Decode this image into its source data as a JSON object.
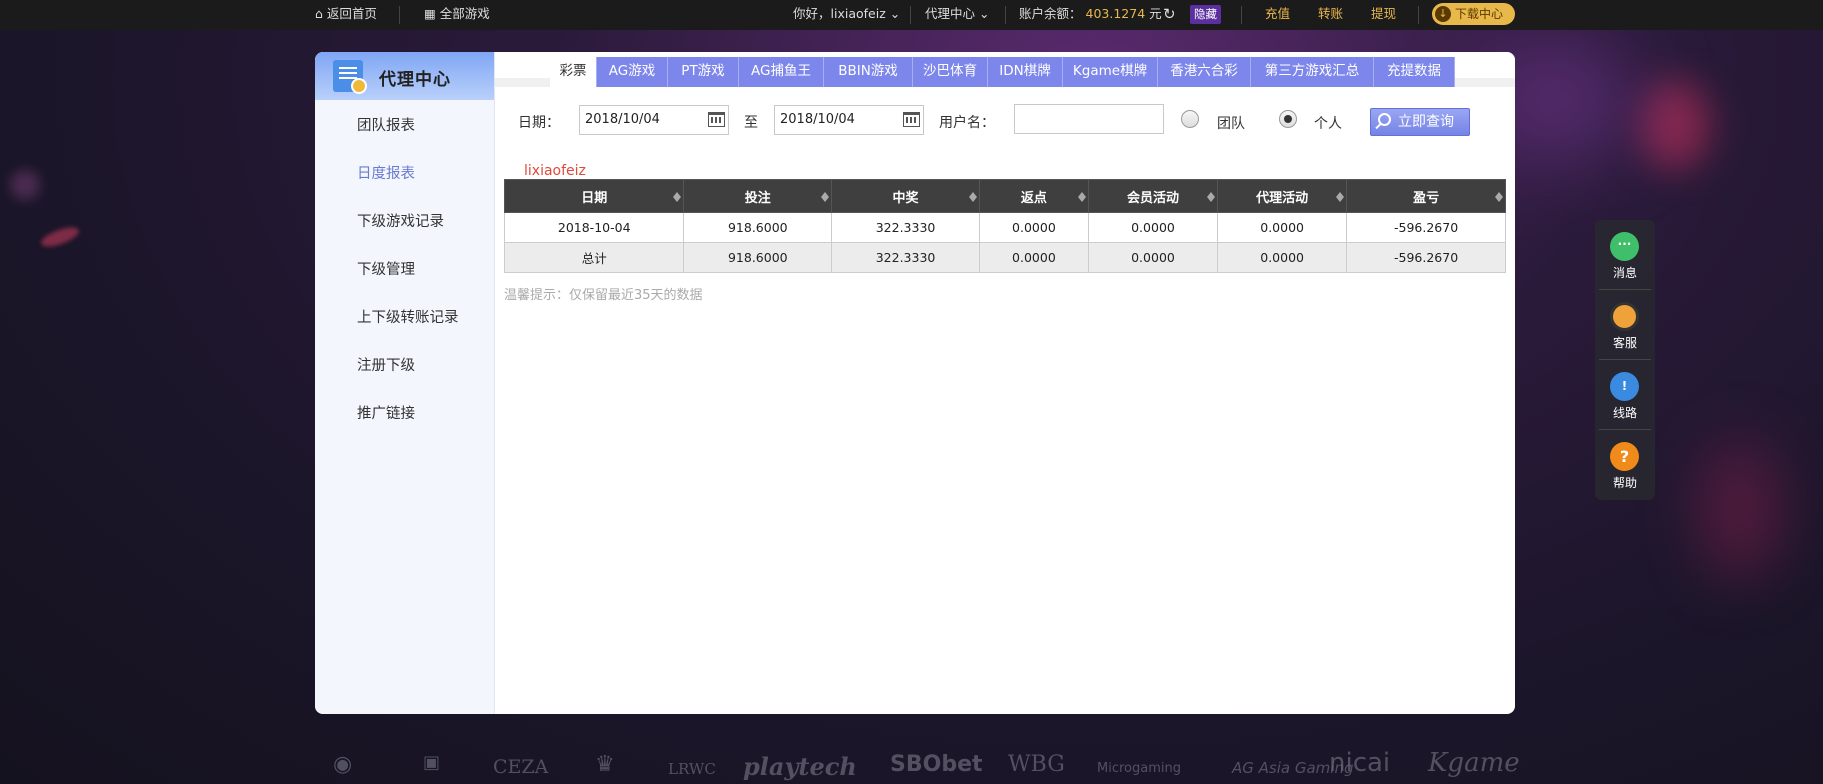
{
  "topbar": {
    "home": "返回首页",
    "all_games": "全部游戏",
    "greeting": "你好，lixiaofeiz",
    "agent_center": "代理中心",
    "balance_label": "账户余额：",
    "balance_value": "403.1274",
    "balance_unit": "元",
    "hide": "隐藏",
    "recharge": "充值",
    "transfer": "转账",
    "withdraw": "提现",
    "download": "下载中心"
  },
  "sidebar": {
    "title": "代理中心",
    "items": [
      "团队报表",
      "日度报表",
      "下级游戏记录",
      "下级管理",
      "上下级转账记录",
      "注册下级",
      "推广链接"
    ],
    "active_index": 1
  },
  "tabs": [
    "彩票",
    "AG游戏",
    "PT游戏",
    "AG捕鱼王",
    "BBIN游戏",
    "沙巴体育",
    "IDN棋牌",
    "Kgame棋牌",
    "香港六合彩",
    "第三方游戏汇总",
    "充提数据"
  ],
  "filter": {
    "date_label": "日期：",
    "date_from": "2018/10/04",
    "to_label": "至",
    "date_to": "2018/10/04",
    "username_label": "用户名：",
    "username_value": "",
    "team_label": "团队",
    "personal_label": "个人",
    "selected": "个人",
    "query_button": "立即查询"
  },
  "current_user": "lixiaofeiz",
  "table": {
    "headers": [
      "日期",
      "投注",
      "中奖",
      "返点",
      "会员活动",
      "代理活动",
      "盈亏"
    ],
    "rows": [
      [
        "2018-10-04",
        "918.6000",
        "322.3330",
        "0.0000",
        "0.0000",
        "0.0000",
        "-596.2670"
      ],
      [
        "总计",
        "918.6000",
        "322.3330",
        "0.0000",
        "0.0000",
        "0.0000",
        "-596.2670"
      ]
    ]
  },
  "tip": "温馨提示：仅保留最近35天的数据",
  "float_menu": {
    "message": "消息",
    "service": "客服",
    "route": "线路",
    "help": "帮助"
  },
  "partners": [
    "CEZA",
    "LRWC",
    "playtech",
    "SBObet",
    "WBG",
    "Microgaming",
    "AG Asia Gaming",
    "nicai",
    "Kgame"
  ],
  "colors": {
    "accent": "#7d86ea",
    "gold": "#e9b84a",
    "loss": "#e04a3a"
  }
}
